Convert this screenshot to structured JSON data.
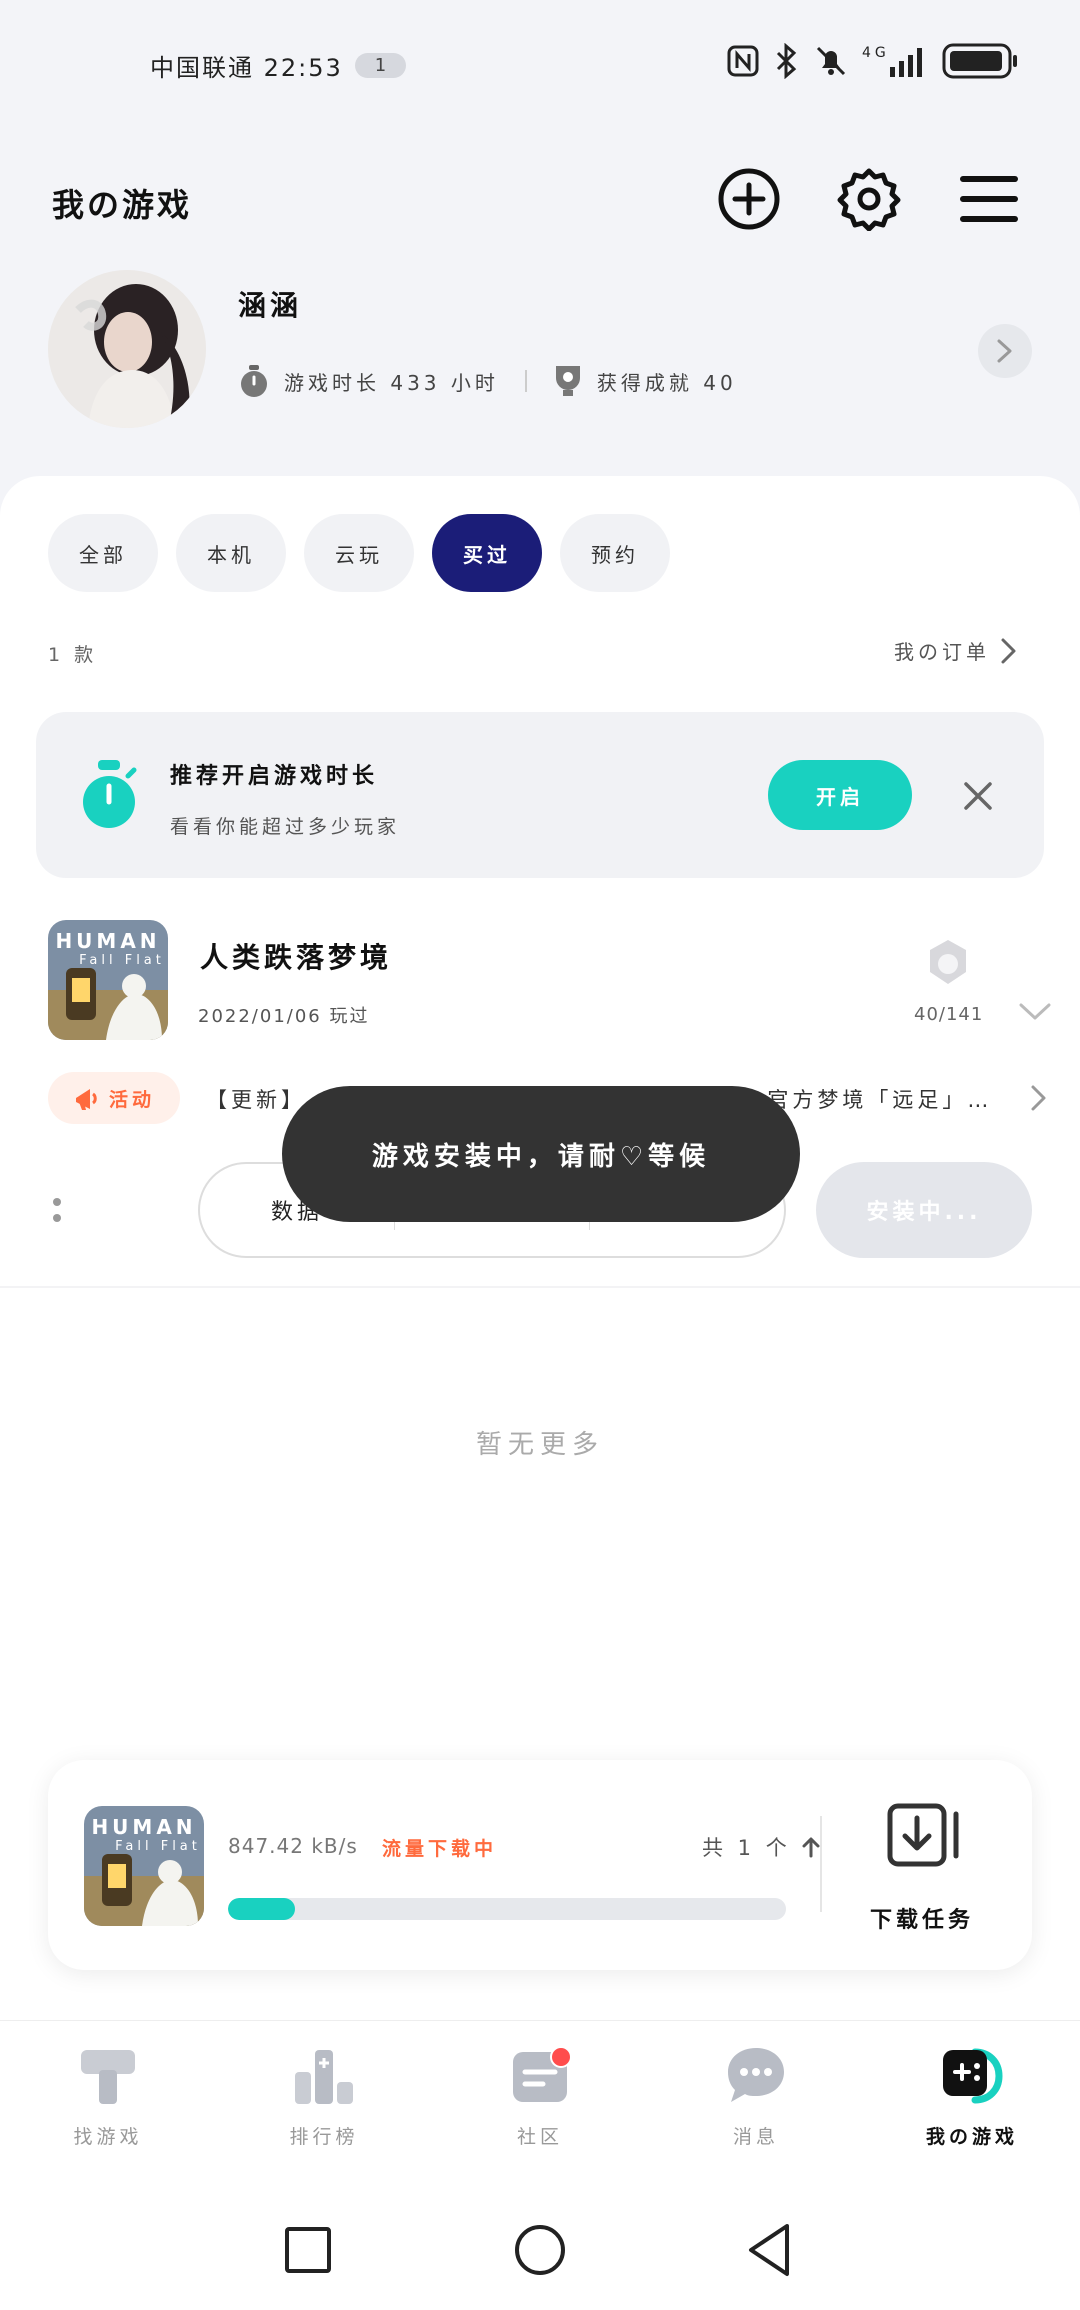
{
  "status_bar": {
    "carrier_time": "中国联通 22:53",
    "notification_count": "1",
    "network": "4G",
    "icons": [
      "nfc-icon",
      "bluetooth-icon",
      "mute-icon",
      "signal-icon",
      "battery-icon"
    ]
  },
  "header": {
    "title": "我の游戏",
    "icons": [
      "add-circle-icon",
      "gear-icon",
      "menu-icon"
    ]
  },
  "profile": {
    "username": "涵涵",
    "playtime_label": "游戏时长 433 小时",
    "achievement_label": "获得成就 40"
  },
  "filters": {
    "tabs": [
      {
        "label": "全部"
      },
      {
        "label": "本机"
      },
      {
        "label": "云玩"
      },
      {
        "label": "买过"
      },
      {
        "label": "预约"
      }
    ],
    "active_index": 3
  },
  "list_meta": {
    "count": "1 款",
    "orders_link": "我の订单"
  },
  "banner": {
    "title": "推荐开启游戏时长",
    "subtitle": "看看你能超过多少玩家",
    "button": "开启"
  },
  "game": {
    "title": "人类跌落梦境",
    "played": "2022/01/06 玩过",
    "achievements": "40/141",
    "thumb_text": "HUMAN",
    "thumb_subtext": "Fall Flat"
  },
  "activity": {
    "badge": "活动",
    "text_left": "【更新】",
    "text_right": "官方梦境「远足」…"
  },
  "actions": {
    "seg1": "数据",
    "seg2": "",
    "seg3": "",
    "install": "安装中..."
  },
  "toast": "游戏安装中，请耐♡等候",
  "end_text": "暂无更多",
  "download": {
    "speed": "847.42 kB/s",
    "status": "流量下载中",
    "total": "共 1 个",
    "progress": 0.12,
    "task_label": "下载任务"
  },
  "bottom_nav": [
    {
      "label": "找游戏",
      "icon": "hammer-icon"
    },
    {
      "label": "排行榜",
      "icon": "ranking-icon"
    },
    {
      "label": "社区",
      "icon": "community-icon"
    },
    {
      "label": "消息",
      "icon": "message-icon"
    },
    {
      "label": "我の游戏",
      "icon": "gamepad-icon"
    }
  ],
  "colors": {
    "accent": "#19d1c0",
    "active_tab": "#1b1d78",
    "orange": "#ff6a3d"
  }
}
